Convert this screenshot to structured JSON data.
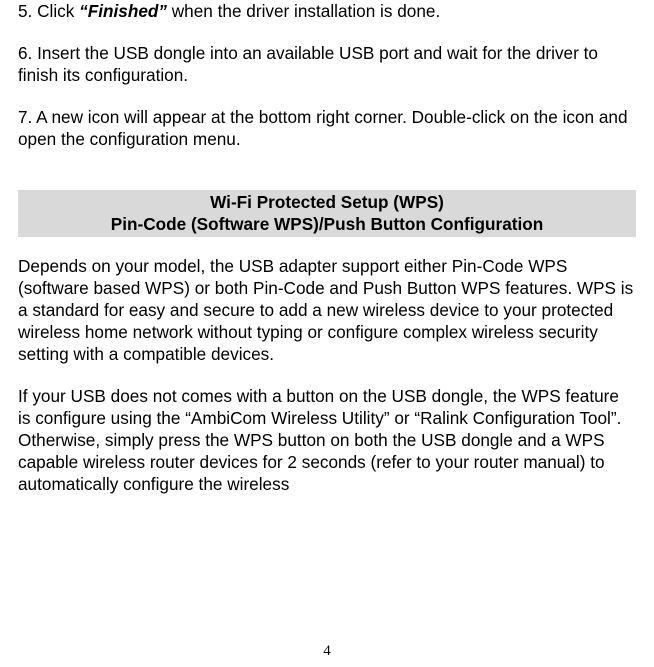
{
  "step5": {
    "pre": "5. Click ",
    "em": "“Finished”",
    "post": " when the driver installation is done."
  },
  "step6": "6. Insert the USB dongle into an available USB port and wait for the driver to finish its configuration.",
  "step7": "7. A new icon will appear at the bottom right corner.  Double-click on the icon and open the configuration menu.",
  "banner": {
    "line1": "Wi-Fi Protected Setup (WPS)",
    "line2": "Pin-Code (Software WPS)/Push Button Configuration"
  },
  "para1": "Depends on your model, the USB adapter support either Pin-Code WPS (software based WPS) or both Pin-Code and Push Button WPS features.  WPS is a standard for easy and secure to add a new wireless device to your protected wireless home network without typing or configure complex wireless security setting with a compatible devices.",
  "para2": "If your USB does not comes with a button on the USB dongle, the WPS feature is configure using the “AmbiCom Wireless Utility” or “Ralink Configuration Tool”. Otherwise, simply press the WPS button on both the USB dongle and a WPS capable wireless router devices for 2 seconds (refer to your router manual) to automatically configure the wireless",
  "pageNumber": "4"
}
